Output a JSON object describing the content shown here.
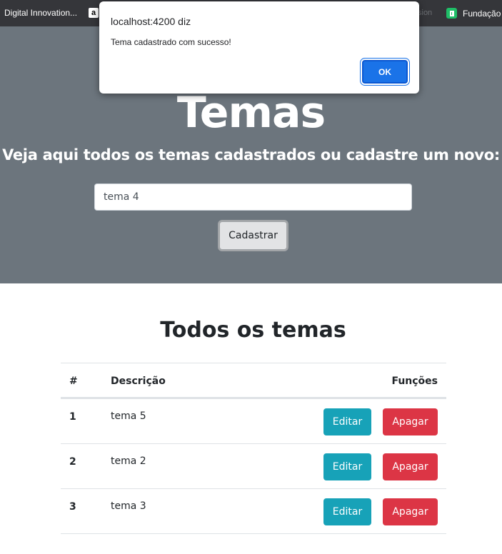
{
  "bookmarks": {
    "items": [
      {
        "label": "Digital Innovation...",
        "icon": "none"
      },
      {
        "label": "a",
        "icon": "amazon-icon"
      },
      {
        "label": "Fundação",
        "icon": "green-bookmark-icon"
      }
    ],
    "faded_text": "sion"
  },
  "dialog": {
    "title": "localhost:4200 diz",
    "message": "Tema cadastrado com sucesso!",
    "ok_label": "OK"
  },
  "hero": {
    "title": "Temas",
    "subtitle": "Veja aqui todos os temas cadastrados ou cadastre um novo:",
    "input_value": "tema 4",
    "submit_label": "Cadastrar"
  },
  "section": {
    "title": "Todos os temas"
  },
  "table": {
    "headers": {
      "num": "#",
      "desc": "Descrição",
      "func": "Funções"
    },
    "edit_label": "Editar",
    "delete_label": "Apagar",
    "rows": [
      {
        "num": "1",
        "desc": "tema 5"
      },
      {
        "num": "2",
        "desc": "tema 2"
      },
      {
        "num": "3",
        "desc": "tema 3"
      }
    ]
  },
  "colors": {
    "hero_bg": "#6c757d",
    "edit": "#17a2b8",
    "delete": "#dc3545",
    "dialog_ok": "#1a73e8"
  }
}
